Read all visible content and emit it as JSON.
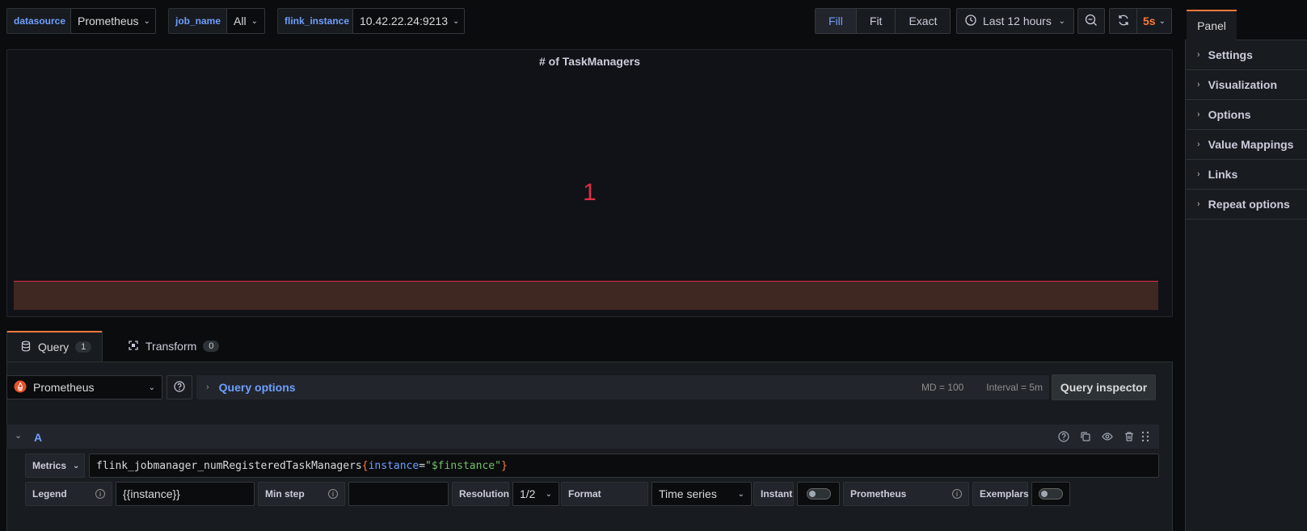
{
  "variables": {
    "datasource": {
      "label": "datasource",
      "value": "Prometheus"
    },
    "job_name": {
      "label": "job_name",
      "value": "All"
    },
    "flink_instance": {
      "label": "flink_instance",
      "value": "10.42.22.24:9213"
    }
  },
  "toolbar": {
    "fit_modes": [
      "Fill",
      "Fit",
      "Exact"
    ],
    "active_fit": "Fill",
    "time_range": "Last 12 hours",
    "refresh_interval": "5s"
  },
  "panel": {
    "title": "# of TaskManagers",
    "value": "1",
    "colors": {
      "value": "#e02f44",
      "spark_fill": "#3f2722"
    }
  },
  "tabs": [
    {
      "label": "Query",
      "count": "1"
    },
    {
      "label": "Transform",
      "count": "0"
    }
  ],
  "query_header": {
    "datasource": "Prometheus",
    "query_options_label": "Query options",
    "md": "MD = 100",
    "interval": "Interval = 5m",
    "inspector_label": "Query inspector"
  },
  "query": {
    "ref_id": "A",
    "metrics_label": "Metrics",
    "expr_metric": "flink_jobmanager_numRegisteredTaskManagers",
    "expr_open": "{",
    "expr_label": "instance",
    "expr_eq": "=",
    "expr_value": "\"$finstance\"",
    "expr_close": "}",
    "legend_label": "Legend",
    "legend_value": "{{instance}}",
    "min_step_label": "Min step",
    "min_step_value": "",
    "resolution_label": "Resolution",
    "resolution_value": "1/2",
    "format_label": "Format",
    "format_value": "Time series",
    "instant_label": "Instant",
    "prometheus_label": "Prometheus",
    "exemplars_label": "Exemplars"
  },
  "right_panel": {
    "tab": "Panel",
    "items": [
      "Settings",
      "Visualization",
      "Options",
      "Value Mappings",
      "Links",
      "Repeat options"
    ]
  }
}
